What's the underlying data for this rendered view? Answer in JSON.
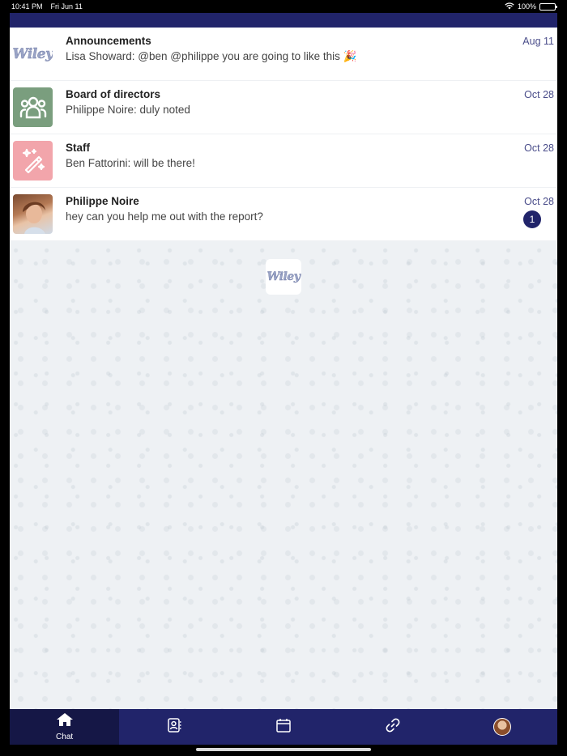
{
  "status_bar": {
    "time": "10:41 PM",
    "date": "Fri Jun 11",
    "battery": "100%"
  },
  "chats": [
    {
      "title": "Announcements",
      "preview": "Lisa Showard: @ben @philippe you are going to like this 🎉",
      "date": "Aug 11",
      "avatar": "wiley-logo",
      "logo_text": "Wiley"
    },
    {
      "title": "Board of directors",
      "preview": "Philippe Noire: duly noted",
      "date": "Oct 28",
      "avatar": "group-icon"
    },
    {
      "title": "Staff",
      "preview": "Ben Fattorini: will be there!",
      "date": "Oct 28",
      "avatar": "magic-wand-icon"
    },
    {
      "title": "Philippe Noire",
      "preview": "hey can you help me out with the report?",
      "date": "Oct 28",
      "avatar": "user-photo",
      "unread": "1"
    }
  ],
  "center_logo": {
    "text": "Wiley"
  },
  "tabs": [
    {
      "label": "Chat",
      "icon": "home-icon",
      "active": true
    },
    {
      "label": "",
      "icon": "contacts-icon"
    },
    {
      "label": "",
      "icon": "calendar-icon"
    },
    {
      "label": "",
      "icon": "link-icon"
    },
    {
      "label": "",
      "icon": "profile-avatar"
    }
  ],
  "colors": {
    "nav": "#21246a",
    "nav_active": "#151746",
    "date": "#4a4d8a",
    "group_avatar": "#7a9e7e",
    "staff_avatar": "#f2a5ab"
  }
}
